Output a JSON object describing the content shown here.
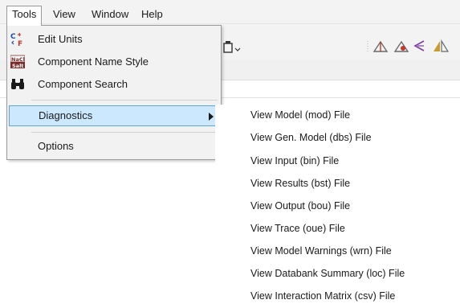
{
  "menubar": {
    "items": [
      "Tools",
      "View",
      "Window",
      "Help"
    ]
  },
  "toolbar": {
    "icons": [
      "copy-icon",
      "pressure-relief-icon",
      "flare-icon",
      "valve-icon",
      "triangle-icon"
    ]
  },
  "tools_menu": {
    "items": [
      {
        "label": "Edit Units",
        "icon": "edit-units-icon"
      },
      {
        "label": "Component Name Style",
        "icon": "name-style-icon"
      },
      {
        "label": "Component Search",
        "icon": "binoculars-icon"
      },
      {
        "label": "Diagnostics",
        "has_submenu": true,
        "highlighted": true
      },
      {
        "label": "Options"
      }
    ]
  },
  "diagnostics_submenu": {
    "items": [
      "View Model (mod) File",
      "View Gen. Model (dbs) File",
      "View Input (bin) File",
      "View Results (bst) File",
      "View Output (bou) File",
      "View Trace (oue) File",
      "View Model Warnings (wrn) File",
      "View Databank Summary (loc) File",
      "View Interaction Matrix (csv) File"
    ]
  },
  "colors": {
    "highlight_bg": "#cce8ff",
    "highlight_border": "#5fa2d6",
    "menu_bg": "#f2f2f2"
  }
}
